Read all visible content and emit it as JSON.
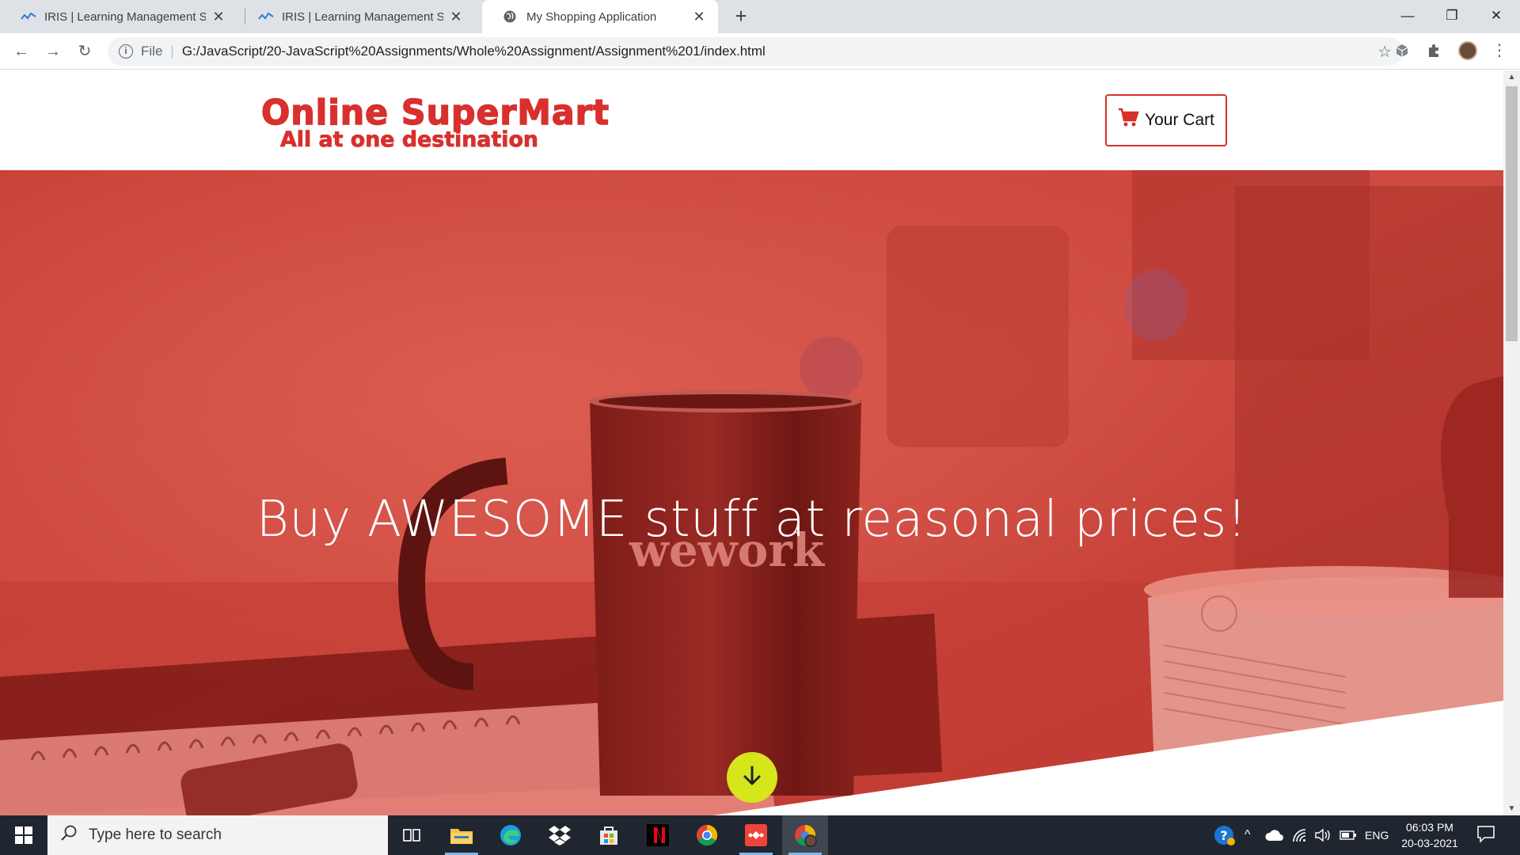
{
  "browser": {
    "tabs": [
      {
        "title": "IRIS | Learning Management Syst",
        "active": false
      },
      {
        "title": "IRIS | Learning Management Syst",
        "active": false
      },
      {
        "title": "My Shopping Application",
        "active": true
      }
    ],
    "omnibox": {
      "scheme": "File",
      "url": "G:/JavaScript/20-JavaScript%20Assignments/Whole%20Assignment/Assignment%201/index.html"
    }
  },
  "site": {
    "logo": {
      "title": "Online SuperMart",
      "tagline": "All at one destination"
    },
    "cart_label": "Your Cart",
    "hero": {
      "headline": "Buy AWESOME stuff at reasonal prices!",
      "mug_text": "wework"
    }
  },
  "taskbar": {
    "search_placeholder": "Type here to search",
    "language": "ENG",
    "time": "06:03 PM",
    "date": "20-03-2021"
  },
  "colors": {
    "brand_red": "#d7302d",
    "hero_overlay": "#c8372f",
    "accent_yellow": "#d7e51b"
  }
}
